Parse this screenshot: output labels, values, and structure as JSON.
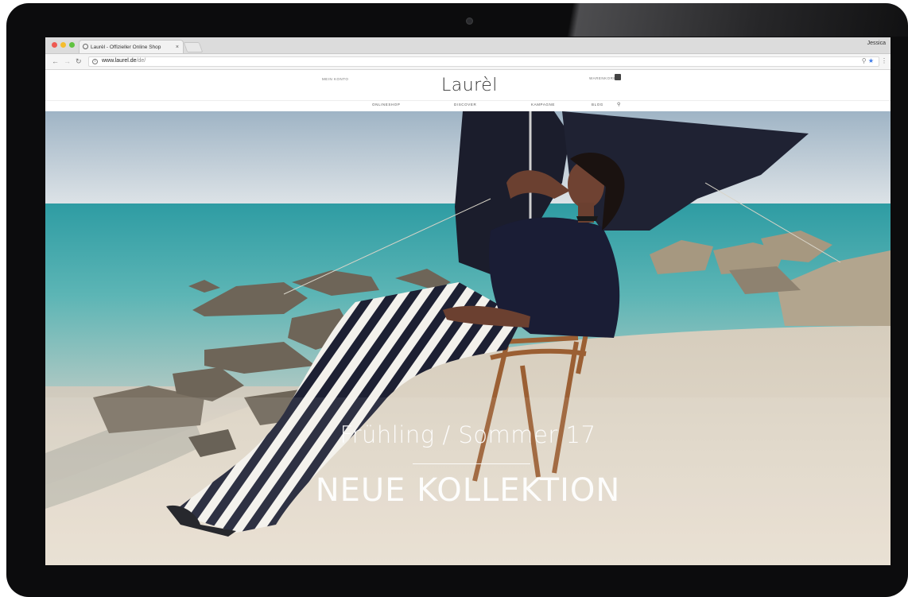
{
  "browser": {
    "tab_title": "Laurèl - Offizieller Online Shop",
    "tab_close": "×",
    "profile_name": "Jessica",
    "url_host": "www.laurel.de",
    "url_path": "/de/"
  },
  "header": {
    "account_label": "MEIN KONTO",
    "logo": "Laurèl",
    "cart_label": "WARENKORB"
  },
  "nav": {
    "items": [
      {
        "label": "ONLINESHOP"
      },
      {
        "label": "DISCOVER"
      },
      {
        "label": "KAMPAGNE"
      },
      {
        "label": "BLOG"
      }
    ]
  },
  "hero": {
    "subtitle": "Frühling / Sommer 17",
    "title": "NEUE KOLLEKTION"
  },
  "colors": {
    "bezel": "#0c0c0d",
    "hero_text": "#ffffff",
    "logo_text": "#333333"
  },
  "icons": [
    "info-icon",
    "search-icon",
    "star-icon",
    "menu-dots-icon",
    "bag-icon",
    "back-icon",
    "forward-icon",
    "reload-icon"
  ]
}
